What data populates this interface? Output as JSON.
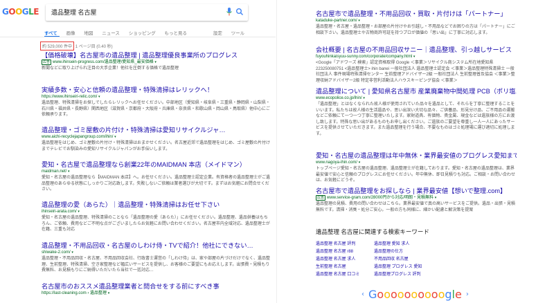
{
  "search": {
    "logo_text": "GOOGLE",
    "query": "遺品整理 名古屋"
  },
  "tabs": {
    "items": [
      "すべて",
      "画像",
      "地図",
      "ニュース",
      "ショッピング",
      "もっと見る"
    ],
    "settings": "設定",
    "tools": "ツール"
  },
  "stats": {
    "count": "約 529,000 件中",
    "page": "1 ページ目 (0.40 秒)"
  },
  "left_results": [
    {
      "title": "【価格破壊】名古屋市の遺品整理 | 遺品整理優良事業所のプログレス",
      "ad": "広告",
      "url": "www.ihinsein-progress.com/遺品整理/愛知県_最安価格",
      "snippet": "新聞などに取り上げられ注目の大手企業！他社を圧倒する価格で遺品整理"
    },
    {
      "title": "実績多数・安心と信頼の遺品整理・特殊清掃はレリックへ！",
      "url": "https://www.ihinseiri-relic.com/",
      "snippet": "遺品整理、特殊清掃をお探しでしたらレリックへお任せください。中部地区（愛知県・岐阜県・三重県・静岡県・山梨県・石川県・福井県・長野県）関西地区（滋賀県・京都府・大阪府・兵庫県・奈良県・和歌山県・岡山県・鳥取県）他中心にご依頼承ります。"
    },
    {
      "title": "遺品整理・ゴミ屋敷の片付け・特殊清掃は愛知リサイクルジャ…",
      "url": "www.aichi-recyclejapangroup.com/ihin/",
      "snippet": "遺品整理をはじめ、ゴミ屋敷の片付け・特殊清掃はおまかせください。名古屋近郊で遺品整理をはじめ、ゴミ屋敷の片付けまでテレビでお馴染みの愛知リサイクルジャパンがお手伝いします。"
    },
    {
      "title": "愛知・名古屋で遺品整理なら創業22年のMAIDMAN 本店（メイドマン）",
      "url": "maidman.net/",
      "snippet": "愛知・名古屋の遺品整理なら【MAIDMAN 本店】へ。お任せください。遺品整理士認定企業。有資格者の遺品整理士がご遺品整理のあらゆる状態にしっかりご対応致します。失敗しないご依頼は業者選びが大切です。まずはお気軽にお問合せください。"
    },
    {
      "title": "遺品整理の愛（あらた）｜遺品整理・特殊清掃はお任せ下さい",
      "url": "ihinseiri-arata.com/",
      "snippet": "愛知・名古屋の遺品整理、特殊清掃のことなら「遺品整理の愛（あらた）」にお任せください。遺品整理、遺品供養はもちろん、ご依頼、費用などご不明な点がございましたらお気軽にお問い合わせください。名古屋市内全域対応、遺品整理士が在籍、三重も対応"
    },
    {
      "title": "遺品整理・不用品回収・名古屋のしわけ侍・TVで紹介！他社にできない…",
      "url": "shiwake-2.com/",
      "snippet": "遺品整理・不用品回収・名古屋、不用品回収会社、行政書士運営の「しわけ侍」は、家や部屋の片づけだけでなく、遺品整理、生前整理、特殊清掃、空き家整理など幅広いサービスを提供し、お客様のご要望にもお応えします。出張費・見積もり費無料、お見積もりにご納得いただいたら当社で一括対応…"
    },
    {
      "title": "名古屋市のおススメ遺品整理業者と問合せをする前にすべき事",
      "url": "https://last-cleaning.com › 遺品整理",
      "snippet": ""
    }
  ],
  "right_results": [
    {
      "title": "名古屋市で遺品整理・不用品回収・買取・片付けは「パートナー」",
      "url": "katadukе-partner.com/",
      "snippet": "遺品整理・名古屋・遺品整理・お部屋の片付けやお引越し・不用品などでお困りの方は「パートナー」にご相談下さい。遺品整理士や古物商許可証を持つプロが価値の「思い出」に丁寧に対応します。"
    },
    {
      "title": "会社概要 | 名古屋の不用品回収サニー｜遺品整理、引っ越しサービス",
      "url": "fuyouhinkaisyuu-sunny.com/corporate/company.html",
      "snippet": "<Google「アドワーズ 検索」認定資格取得 Google ＜事業＞リサイクル商システム所在地愛知県223250080751 <遺品整理士> ihin banei 一般社団法人 遺品整理士認定会 ＜事業＞遺品整理特殊清掃士 一般社団法人 事件現場特殊清掃センター 生前整理アドバイザー2級 一般社団法人 生前整理普及協会 ＜事業＞整理収納アドバイザー2級 特定非営利活動法人ハウスキーピング協会 ＜事業＞"
    },
    {
      "title": "遺品整理について | 愛知県名古屋市 産業廃棄物中間処理 PCB（ポリ塩…",
      "url": "www.ecopolice.co.jp/ihin/",
      "snippet": "「遺品整理」とはなくなられた故人様が使用されていた品々を遺品として、それらを丁寧に整理することをいいます。私たちは故人様の生活遺品や、思い出深い大切な品々、ご供養品、形見分け品、ご不用品の運搬などご依頼にて一つ一つ丁寧に整理いたします。家財道具、有価物、貴金属、現金などは遺族様の方にお渡し致します。特殊な思い出があるものもお申し出ください。ご遺族のご要望を尊重し一人一人にあったサービスを提供させていただきます。また遺品整理を行う場合、不要なものはゴミ処理場に運び適切に処理します。"
    },
    {
      "title": "愛知・名古屋の遺品整理は年中無休・業界最安値のプログレス愛知まで",
      "url": "www.nagoya-ihin.com/",
      "snippet": "トップページ愛知・名古屋の遺品整理、遺品整理士が在籍しております。愛知・名古屋の遺品整理は、業界最安値で安心と信頼のプログレスにお任せください。年中無休、即日見積りも対応。ご相談・お問い合わせは、お気軽にどうぞ。"
    },
    {
      "title": "名古屋市で遺品整理をお探しなら | 業界最安値【想いで整理.com】",
      "ad": "広告",
      "url": "www.service-gram.com/28000円から対応/明朗・見積無料",
      "snippet": "遺品整理の見積、費用の問い合わせはこちら。業界最安値で真の高いサービスをご提供。遺品・出張・見積無料です。清掃・消臭・処分ご安心。一般の方も同様に、細かい配慮と解決策を提案"
    }
  ],
  "related": {
    "heading": "遺品整理 名古屋に関連する検索キーワード",
    "col1": [
      "遺品整理 名古屋 評判",
      "遺品整理 名古屋 r88",
      "遺品整理 名古屋 求人",
      "生前整理 名古屋",
      "遺品整理 名古屋 口コミ"
    ],
    "col2": [
      "遺品整理 愛知 求人",
      "遺品整理の仕方",
      "不用品回収 名古屋",
      "遺品整理 プログレス 愛知",
      "遺品整理プログレス 評判"
    ]
  },
  "pager": {
    "prev": "‹",
    "next": "›",
    "text": "Goooooooooogle"
  }
}
